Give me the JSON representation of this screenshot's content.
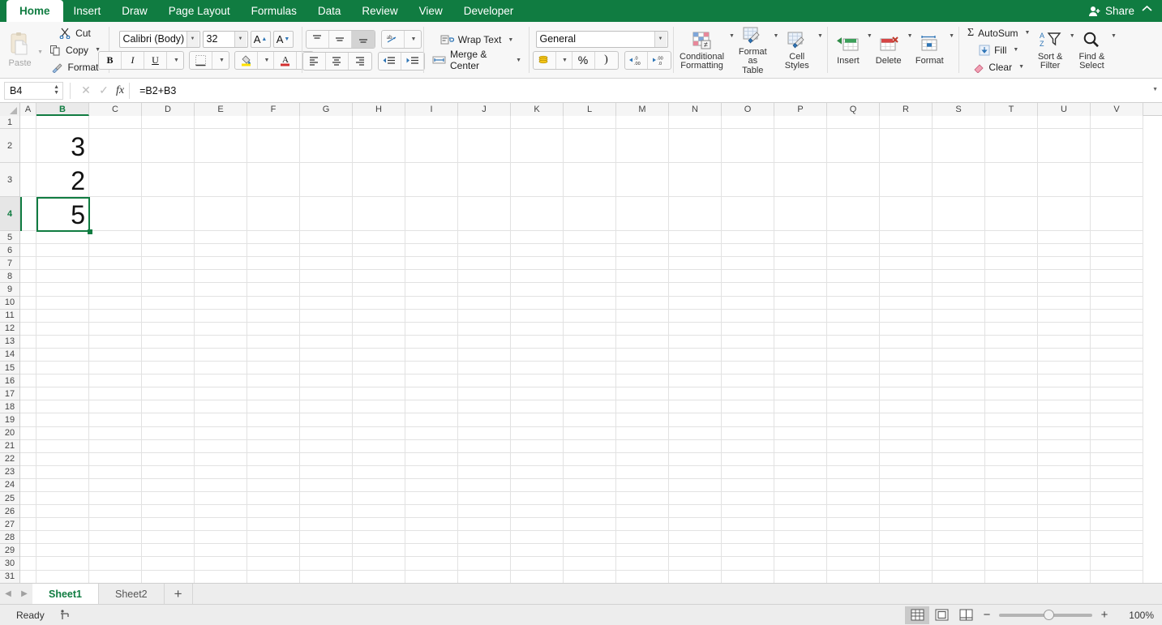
{
  "tabs": {
    "items": [
      {
        "label": "Home",
        "active": true
      },
      {
        "label": "Insert",
        "active": false
      },
      {
        "label": "Draw",
        "active": false
      },
      {
        "label": "Page Layout",
        "active": false
      },
      {
        "label": "Formulas",
        "active": false
      },
      {
        "label": "Data",
        "active": false
      },
      {
        "label": "Review",
        "active": false
      },
      {
        "label": "View",
        "active": false
      },
      {
        "label": "Developer",
        "active": false
      }
    ],
    "share_label": "Share",
    "collapse_icon": "chevron-up-icon"
  },
  "ribbon": {
    "clipboard": {
      "paste_label": "Paste",
      "cut_label": "Cut",
      "copy_label": "Copy",
      "format_painter_label": "Format"
    },
    "font": {
      "font_name": "Calibri (Body)",
      "font_size": "32",
      "grow_label": "A",
      "shrink_label": "A",
      "bold_label": "B",
      "italic_label": "I",
      "underline_label": "U"
    },
    "alignment": {
      "wrap_text_label": "Wrap Text",
      "merge_center_label": "Merge & Center",
      "active_vertical_align": "bottom"
    },
    "number": {
      "format_value": "General",
      "percent_label": "%"
    },
    "styles": {
      "conditional_formatting_label": "Conditional\nFormatting",
      "conditional_formatting_line1": "Conditional",
      "conditional_formatting_line2": "Formatting",
      "format_as_table_line1": "Format",
      "format_as_table_line2": "as Table",
      "cell_styles_line1": "Cell",
      "cell_styles_line2": "Styles"
    },
    "cells": {
      "insert_label": "Insert",
      "delete_label": "Delete",
      "format_label": "Format"
    },
    "editing": {
      "autosum_label": "AutoSum",
      "fill_label": "Fill",
      "clear_label": "Clear",
      "sort_filter_line1": "Sort &",
      "sort_filter_line2": "Filter",
      "find_select_line1": "Find &",
      "find_select_line2": "Select"
    }
  },
  "formula_bar": {
    "name_box": "B4",
    "cancel_icon": "close-icon",
    "confirm_icon": "check-icon",
    "fx_label": "fx",
    "formula": "=B2+B3"
  },
  "grid": {
    "columns": [
      "A",
      "B",
      "C",
      "D",
      "E",
      "F",
      "G",
      "H",
      "I",
      "J",
      "K",
      "L",
      "M",
      "N",
      "O",
      "P",
      "Q",
      "R",
      "S",
      "T",
      "U",
      "V"
    ],
    "selected_column": "B",
    "selected_row": 4,
    "rows": [
      1,
      2,
      3,
      4,
      5,
      6,
      7,
      8,
      9,
      10,
      11,
      12,
      13,
      14,
      15,
      16,
      17,
      18,
      19,
      20,
      21,
      22,
      23,
      24,
      25,
      26,
      27,
      28,
      29,
      30,
      31
    ],
    "tall_rows": [
      2,
      3,
      4
    ],
    "cells": [
      {
        "ref": "B2",
        "value": "3"
      },
      {
        "ref": "B3",
        "value": "2"
      },
      {
        "ref": "B4",
        "value": "5"
      }
    ],
    "selection": "B4"
  },
  "sheet_tabs": {
    "items": [
      {
        "label": "Sheet1",
        "active": true
      },
      {
        "label": "Sheet2",
        "active": false
      }
    ],
    "add_label": "+"
  },
  "status_bar": {
    "state": "Ready",
    "accessibility_icon": "accessibility-check-icon",
    "views": [
      {
        "name": "normal-view",
        "active": true
      },
      {
        "name": "page-layout-view",
        "active": false
      },
      {
        "name": "page-break-view",
        "active": false
      }
    ],
    "zoom_out": "−",
    "zoom_in": "+",
    "zoom_level": "100%"
  },
  "colors": {
    "brand_green": "#107C41",
    "selection_green": "#107C41",
    "ribbon_bg": "#F7F7F7",
    "grid_line": "#E2E2E2"
  }
}
